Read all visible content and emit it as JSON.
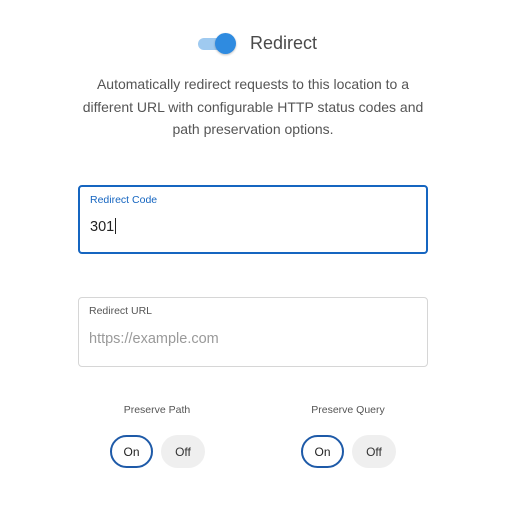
{
  "header": {
    "title": "Redirect",
    "toggle_enabled": true,
    "toggle_color": "#2f8be0"
  },
  "description": "Automatically redirect requests to this location to a different URL with configurable HTTP status codes and path preservation options.",
  "fields": {
    "redirect_code": {
      "label": "Redirect Code",
      "value": "301"
    },
    "redirect_url": {
      "label": "Redirect URL",
      "value": "",
      "placeholder": "https://example.com"
    }
  },
  "options": {
    "preserve_path": {
      "label": "Preserve Path",
      "on_label": "On",
      "off_label": "Off",
      "selected": "On"
    },
    "preserve_query": {
      "label": "Preserve Query",
      "on_label": "On",
      "off_label": "Off",
      "selected": "On"
    }
  }
}
